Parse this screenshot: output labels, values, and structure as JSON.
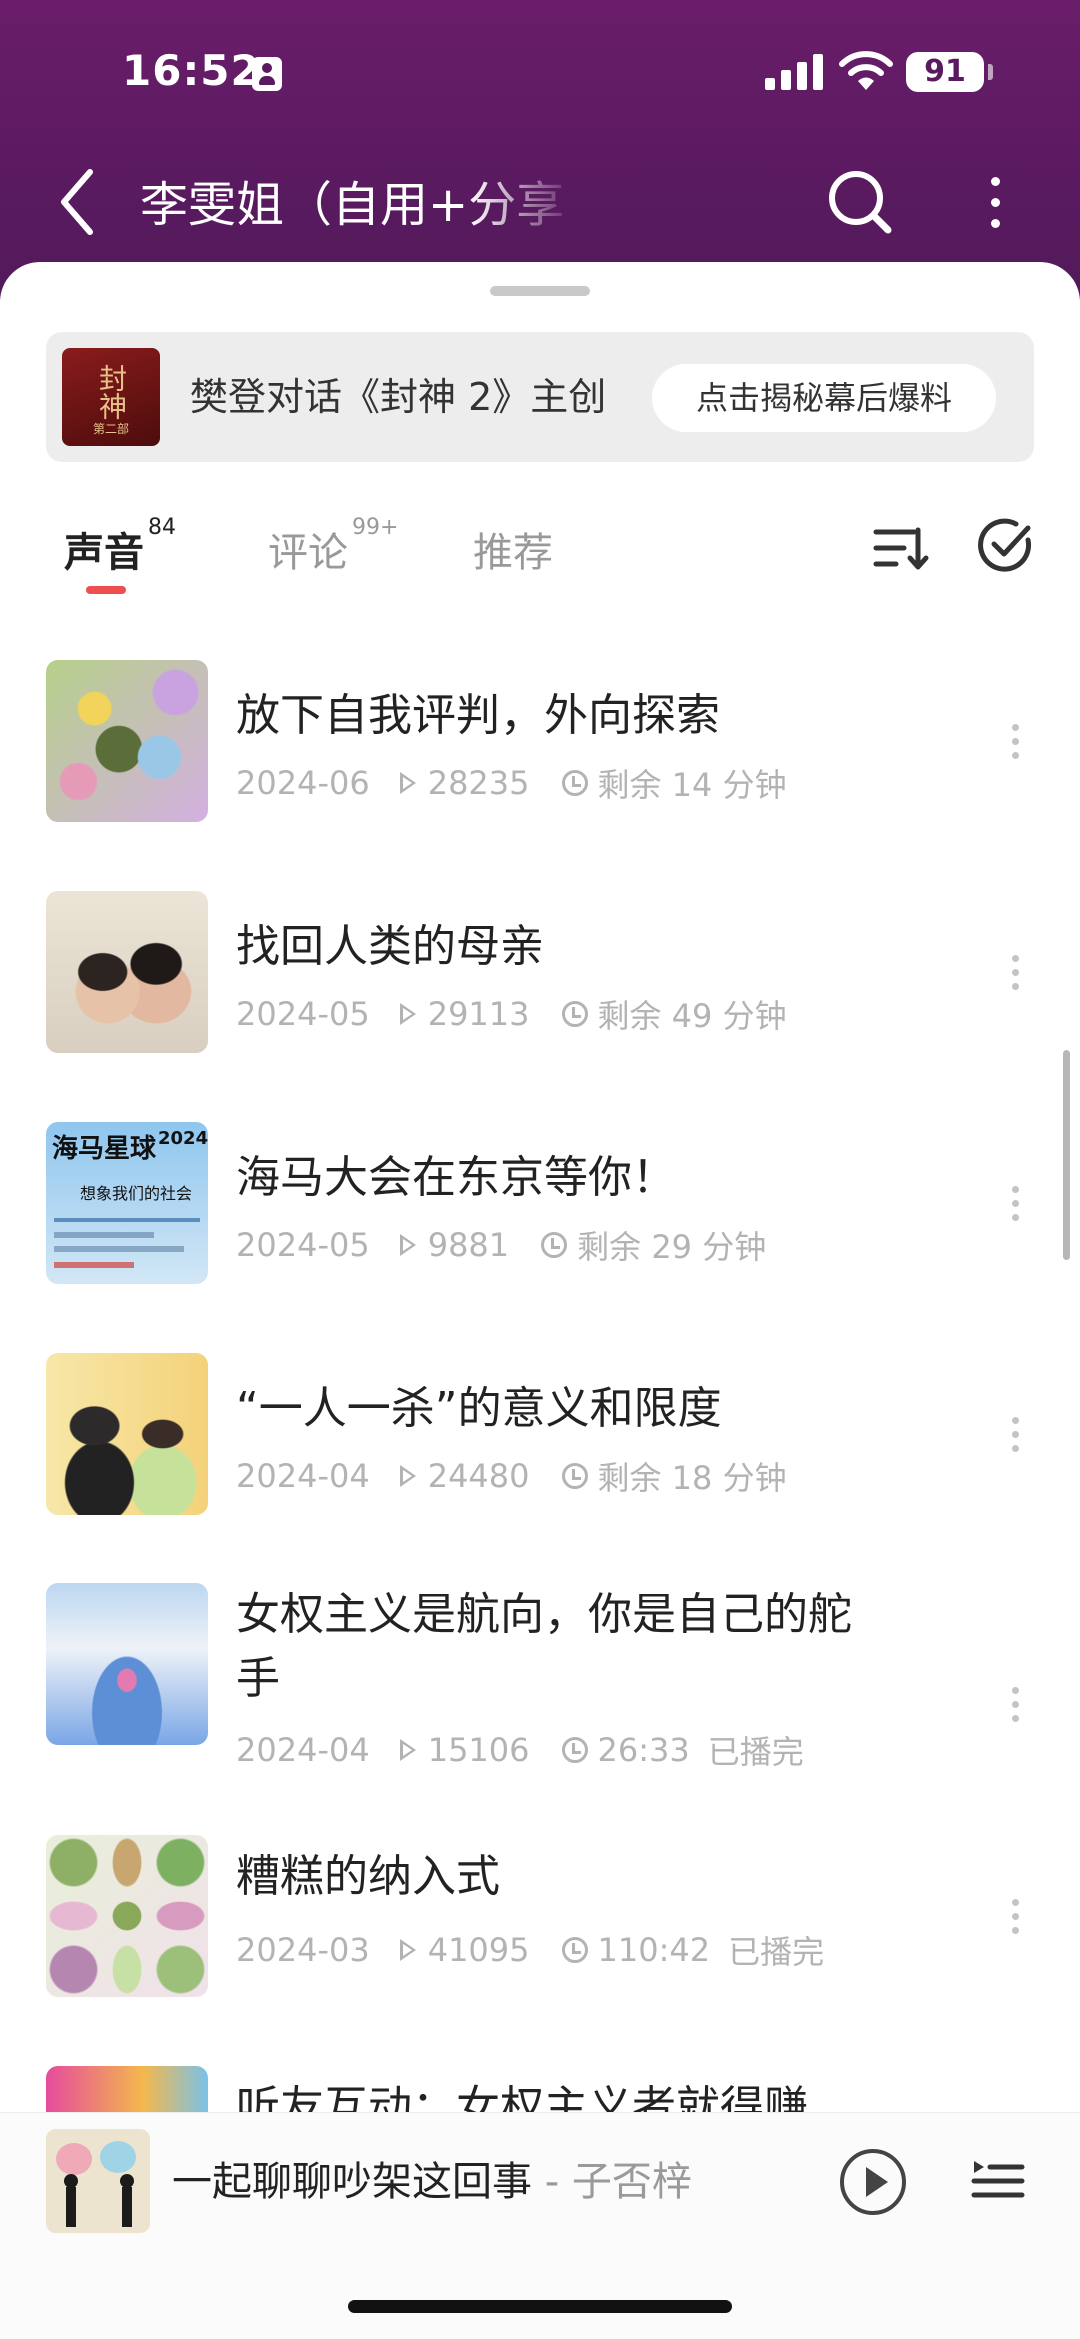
{
  "status_bar": {
    "time": "16:52",
    "battery": "91"
  },
  "nav": {
    "title": "李雯姐（自用+分享"
  },
  "banner": {
    "thumb_text": "封神",
    "thumb_subtext": "第二部",
    "text": "樊登对话《封神 2》主创",
    "button_label": "点击揭秘幕后爆料"
  },
  "tabs": [
    {
      "label": "声音",
      "badge": "84",
      "active": true
    },
    {
      "label": "评论",
      "badge": "99+",
      "active": false
    },
    {
      "label": "推荐",
      "badge": "",
      "active": false
    }
  ],
  "tracks": [
    {
      "title": "放下自我评判，外向探索",
      "date": "2024-06",
      "plays": "28235",
      "duration": "剩余 14 分钟",
      "status": ""
    },
    {
      "title": "找回人类的母亲",
      "date": "2024-05",
      "plays": "29113",
      "duration": "剩余 49 分钟",
      "status": ""
    },
    {
      "title": "海马大会在东京等你！",
      "date": "2024-05",
      "plays": "9881",
      "duration": "剩余 29 分钟",
      "status": ""
    },
    {
      "title": "“一人一杀”的意义和限度",
      "date": "2024-04",
      "plays": "24480",
      "duration": "剩余 18 分钟",
      "status": ""
    },
    {
      "title": "女权主义是航向，你是自己的舵手",
      "date": "2024-04",
      "plays": "15106",
      "duration": "26:33",
      "status": "已播完"
    },
    {
      "title": "糟糕的纳入式",
      "date": "2024-03",
      "plays": "41095",
      "duration": "110:42",
      "status": "已播完"
    },
    {
      "title": "听友互动：女权主义者就得赚",
      "date": "",
      "plays": "",
      "duration": "",
      "status": ""
    }
  ],
  "cover3": {
    "line1": "海马星球",
    "year": "2024",
    "line2": "想象我们的社会"
  },
  "mini_player": {
    "title": "一起聊聊吵架这回事",
    "separator": " - ",
    "author": "子否梓"
  },
  "colors": {
    "header": "#5a1a60",
    "accent": "#f04e4e"
  }
}
